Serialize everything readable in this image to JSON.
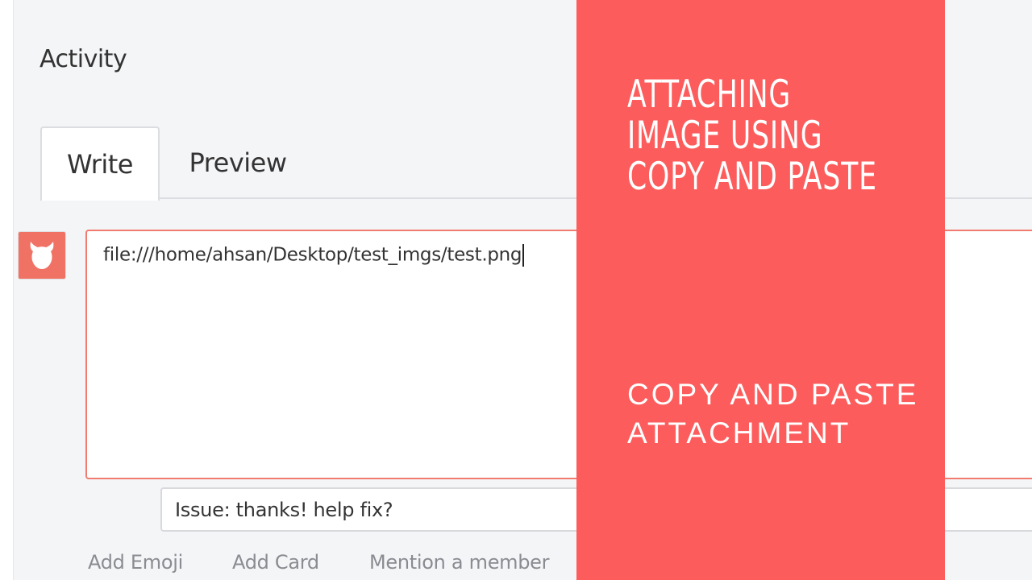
{
  "activity": {
    "title": "Activity"
  },
  "tabs": [
    {
      "label": "Write",
      "active": true
    },
    {
      "label": "Preview",
      "active": false
    }
  ],
  "avatar": {
    "icon": "devil-face-icon",
    "color": "#f07265"
  },
  "comment": {
    "value": "file:///home/ahsan/Desktop/test_imgs/test.png",
    "border_color": "#f07b6e"
  },
  "card_input": {
    "value": "Issue: thanks! help fix?"
  },
  "actions": {
    "add_emoji": "Add Emoji",
    "add_card": "Add Card",
    "mention": "Mention a member"
  },
  "overlay": {
    "title": "Attaching image using copy and paste",
    "subtitle": "copy and paste attachment",
    "color": "#fd5c5c"
  }
}
